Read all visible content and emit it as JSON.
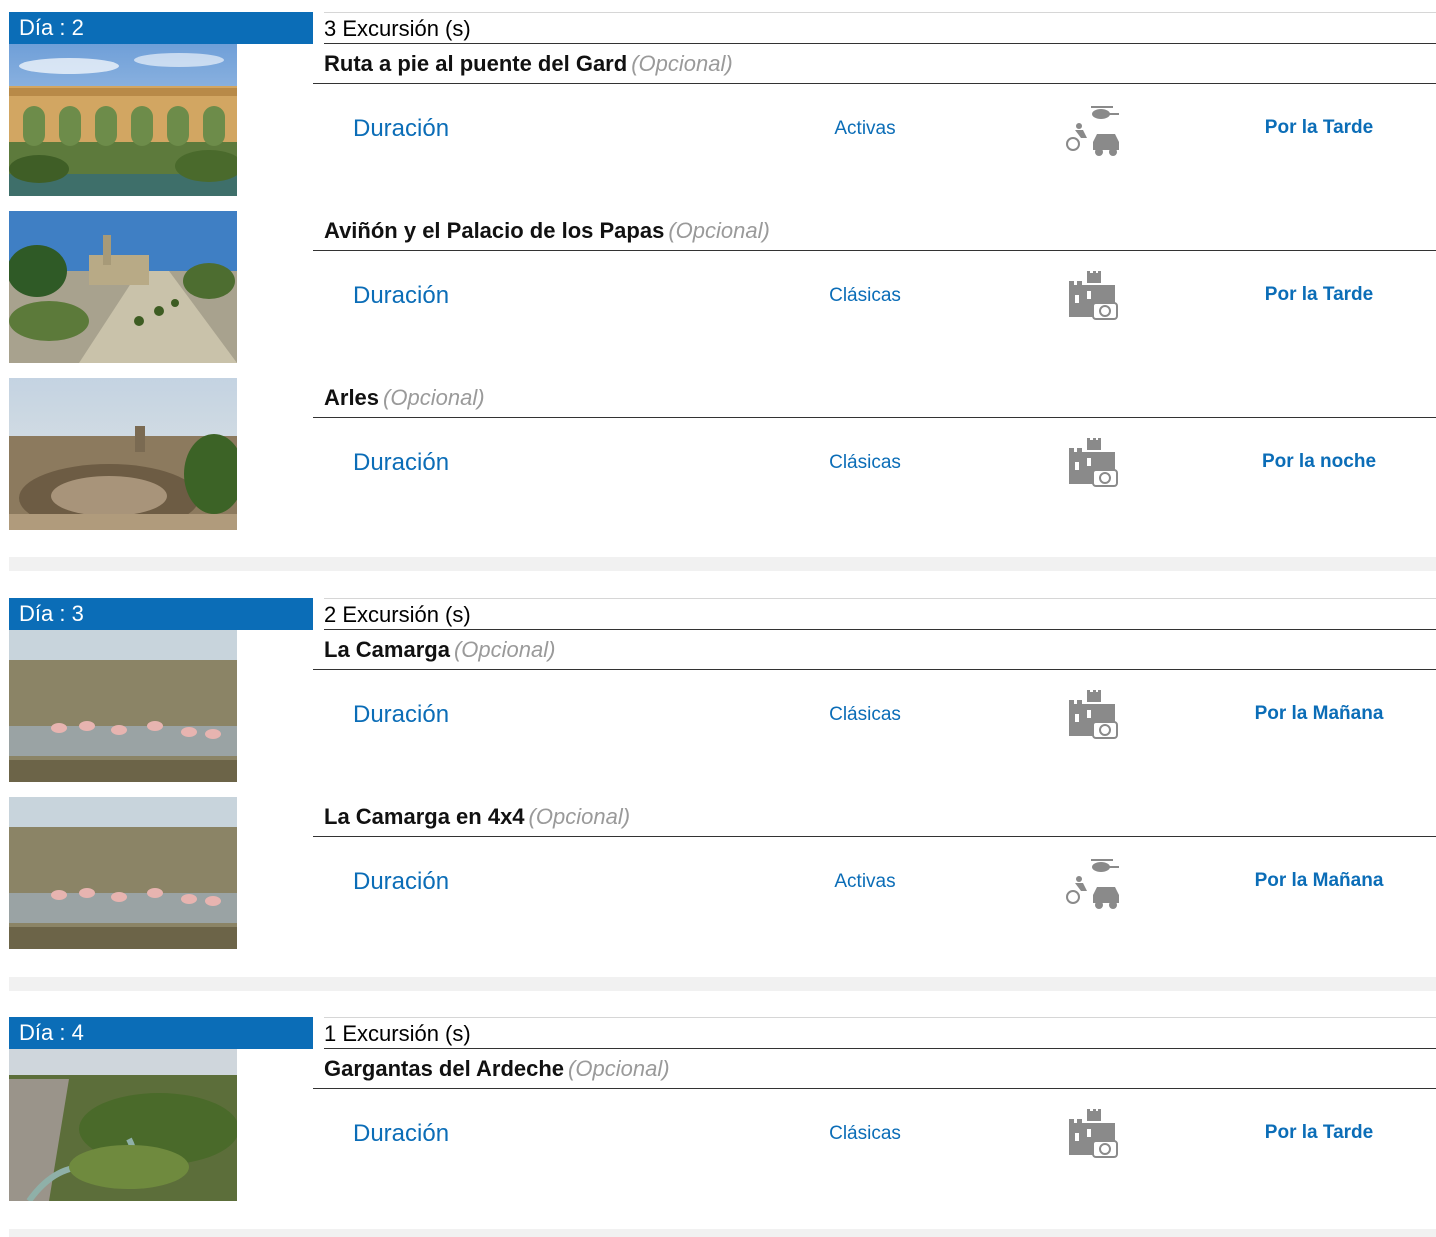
{
  "days": [
    {
      "badge": "Día : 2",
      "count": "3 Excursión (s)",
      "excursions": [
        {
          "name": "Ruta a pie al puente del Gard",
          "optional": "(Opcional)",
          "duration": "Duración",
          "category": "Activas",
          "icon": "active-icon",
          "time": "Por la Tarde",
          "image": "pont-du-gard-photo"
        },
        {
          "name": "Aviñón y el Palacio de los Papas",
          "optional": "(Opcional)",
          "duration": "Duración",
          "category": "Clásicas",
          "icon": "classic-icon",
          "time": "Por la Tarde",
          "image": "avignon-palace-photo"
        },
        {
          "name": "Arles",
          "optional": "(Opcional)",
          "duration": "Duración",
          "category": "Clásicas",
          "icon": "classic-icon",
          "time": "Por la noche",
          "image": "arles-theatre-photo"
        }
      ]
    },
    {
      "badge": "Día : 3",
      "count": "2 Excursión (s)",
      "excursions": [
        {
          "name": "La Camarga",
          "optional": "(Opcional)",
          "duration": "Duración",
          "category": "Clásicas",
          "icon": "classic-icon",
          "time": "Por la Mañana",
          "image": "camargue-flamingos-photo"
        },
        {
          "name": "La Camarga en 4x4",
          "optional": "(Opcional)",
          "duration": "Duración",
          "category": "Activas",
          "icon": "active-icon",
          "time": "Por la Mañana",
          "image": "camargue-flamingos-photo"
        }
      ]
    },
    {
      "badge": "Día : 4",
      "count": "1 Excursión (s)",
      "excursions": [
        {
          "name": "Gargantas del Ardeche",
          "optional": "(Opcional)",
          "duration": "Duración",
          "category": "Clásicas",
          "icon": "classic-icon",
          "time": "Por la Tarde",
          "image": "ardeche-gorges-photo"
        }
      ]
    }
  ],
  "colors": {
    "accent": "#0b6db7",
    "optional": "#9a9a9a",
    "separator": "#f1f1f1"
  }
}
